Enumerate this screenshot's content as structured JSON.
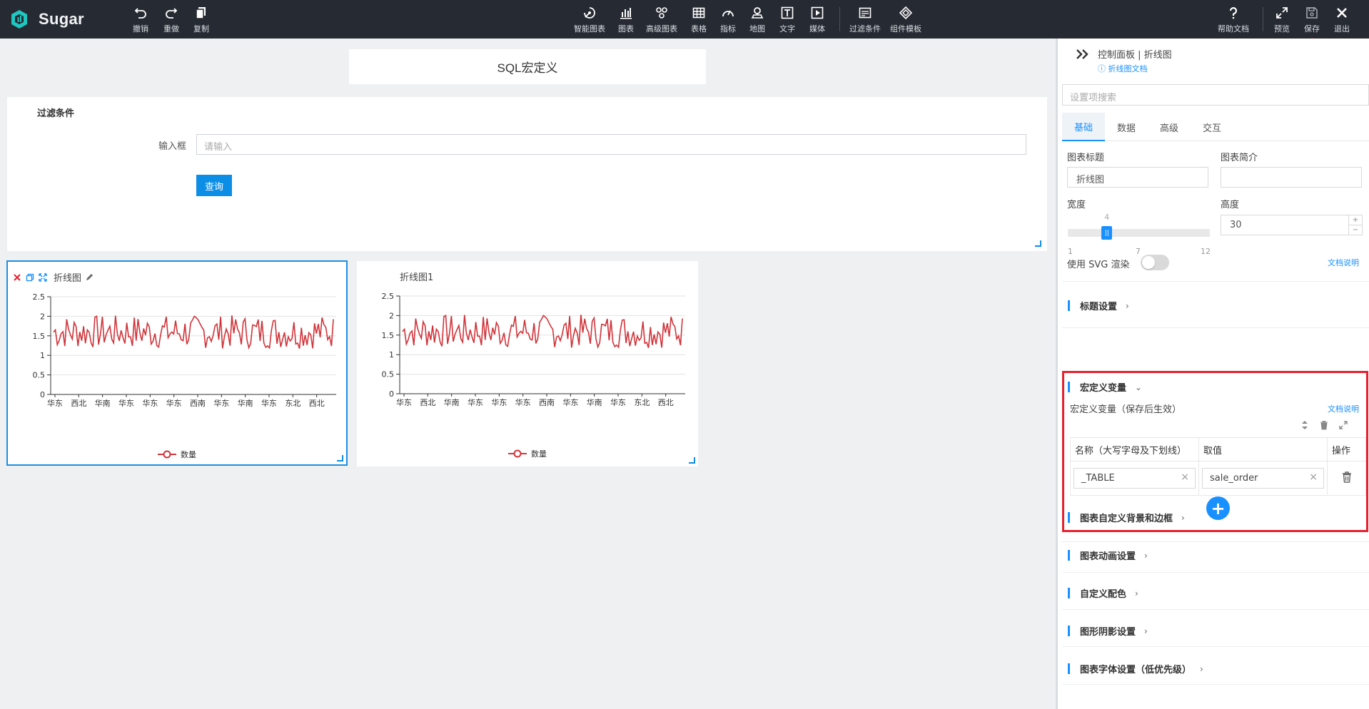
{
  "app": {
    "name": "Sugar"
  },
  "toolbar": {
    "undo": "撤销",
    "redo": "重做",
    "copy": "复制",
    "smart_chart": "智能图表",
    "chart": "图表",
    "advanced_chart": "高级图表",
    "table": "表格",
    "indicator": "指标",
    "map": "地图",
    "text": "文字",
    "media": "媒体",
    "filter": "过滤条件",
    "component_template": "组件模板",
    "help_doc": "帮助文档",
    "preview": "预览",
    "save": "保存",
    "exit": "退出"
  },
  "canvas": {
    "page_title": "SQL宏定义",
    "filter": {
      "title": "过滤条件",
      "input_label": "输入框",
      "input_placeholder": "请输入",
      "query_button": "查询"
    }
  },
  "charts": [
    {
      "title": "折线图",
      "legend": "数量"
    },
    {
      "title": "折线图1",
      "legend": "数量"
    }
  ],
  "chart_data": [
    {
      "type": "line",
      "title": "折线图",
      "ylim": [
        0,
        2.5
      ],
      "yticks": [
        "2.5",
        "2",
        "1.5",
        "1",
        "0.5",
        "0"
      ],
      "xticks": [
        "华东",
        "西北",
        "华南",
        "华东",
        "华东",
        "华东",
        "西南",
        "华东",
        "华南",
        "华东",
        "东北",
        "西北"
      ],
      "series": [
        {
          "name": "数量",
          "color": "#d0343a",
          "mean": 1.6,
          "range": [
            1.2,
            2.1
          ]
        }
      ]
    },
    {
      "type": "line",
      "title": "折线图1",
      "ylim": [
        0,
        2.5
      ],
      "yticks": [
        "2.5",
        "2",
        "1.5",
        "1",
        "0.5",
        "0"
      ],
      "xticks": [
        "华东",
        "西北",
        "华南",
        "华东",
        "华东",
        "华东",
        "西南",
        "华东",
        "华南",
        "华东",
        "东北",
        "西北"
      ],
      "series": [
        {
          "name": "数量",
          "color": "#d0343a",
          "mean": 1.6,
          "range": [
            1.2,
            2.1
          ]
        }
      ]
    }
  ],
  "panel": {
    "breadcrumb": "控制面板 | 折线图",
    "doc_link": "折线图文档",
    "search_placeholder": "设置项搜索",
    "tabs": [
      "基础",
      "数据",
      "高级",
      "交互"
    ],
    "chart_title_label": "图表标题",
    "chart_title_value": "折线图",
    "chart_intro_label": "图表简介",
    "chart_intro_value": "",
    "width_label": "宽度",
    "width_value": 4,
    "width_ticks": [
      "1",
      "7",
      "12"
    ],
    "height_label": "高度",
    "height_value": "30",
    "svg_render_label": "使用 SVG 渲染",
    "doc_note": "文档说明",
    "sections": {
      "title_settings": "标题设置",
      "macro_vars": "宏定义变量",
      "macro_hint": "宏定义变量（保存后生效）",
      "bg_border": "图表自定义背景和边框",
      "animation": "图表动画设置",
      "custom_colors": "自定义配色",
      "shadow": "图形阴影设置",
      "font": "图表字体设置（低优先级）"
    },
    "macro_table": {
      "headers": [
        "名称（大写字母及下划线）",
        "取值",
        "操作"
      ],
      "rows": [
        {
          "name": "_TABLE",
          "value": "sale_order"
        }
      ]
    }
  },
  "colors": {
    "accent": "#1890ff",
    "topbar": "#262b33",
    "highlight": "#e8202e",
    "line": "#d0343a"
  }
}
